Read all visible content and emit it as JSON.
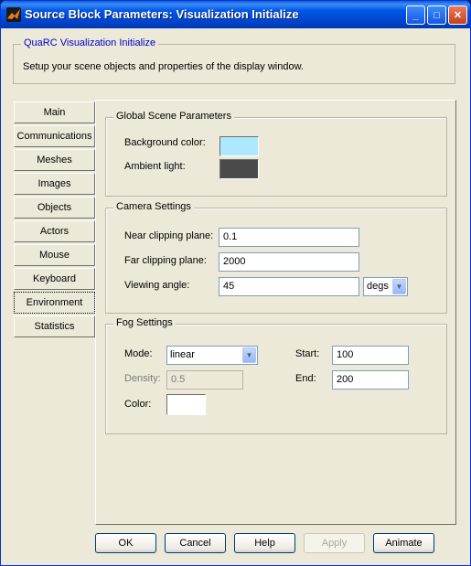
{
  "window": {
    "title": "Source Block Parameters: Visualization Initialize",
    "minimize_glyph": "_",
    "maximize_glyph": "□",
    "close_glyph": "✕"
  },
  "header": {
    "legend": "QuaRC Visualization Initialize",
    "description": "Setup your scene objects and properties of the display window."
  },
  "tabs": [
    {
      "label": "Main"
    },
    {
      "label": "Communications"
    },
    {
      "label": "Meshes"
    },
    {
      "label": "Images"
    },
    {
      "label": "Objects"
    },
    {
      "label": "Actors"
    },
    {
      "label": "Mouse"
    },
    {
      "label": "Keyboard"
    },
    {
      "label": "Environment",
      "selected": true
    },
    {
      "label": "Statistics"
    }
  ],
  "global_scene": {
    "title": "Global Scene Parameters",
    "background_label": "Background color:",
    "background_color": "#aee8ff",
    "ambient_label": "Ambient light:",
    "ambient_color": "#4a4a4a"
  },
  "camera": {
    "title": "Camera Settings",
    "near_label": "Near clipping plane:",
    "near_value": "0.1",
    "far_label": "Far clipping plane:",
    "far_value": "2000",
    "angle_label": "Viewing angle:",
    "angle_value": "45",
    "angle_unit": "degs"
  },
  "fog": {
    "title": "Fog Settings",
    "mode_label": "Mode:",
    "mode_value": "linear",
    "density_label": "Density:",
    "density_value": "0.5",
    "color_label": "Color:",
    "color_value": "#ffffff",
    "start_label": "Start:",
    "start_value": "100",
    "end_label": "End:",
    "end_value": "200"
  },
  "buttons": {
    "ok": "OK",
    "cancel": "Cancel",
    "help": "Help",
    "apply": "Apply",
    "animate": "Animate"
  },
  "icons": {
    "app": "matlab-icon",
    "dropdown": "chevron-down-icon"
  }
}
